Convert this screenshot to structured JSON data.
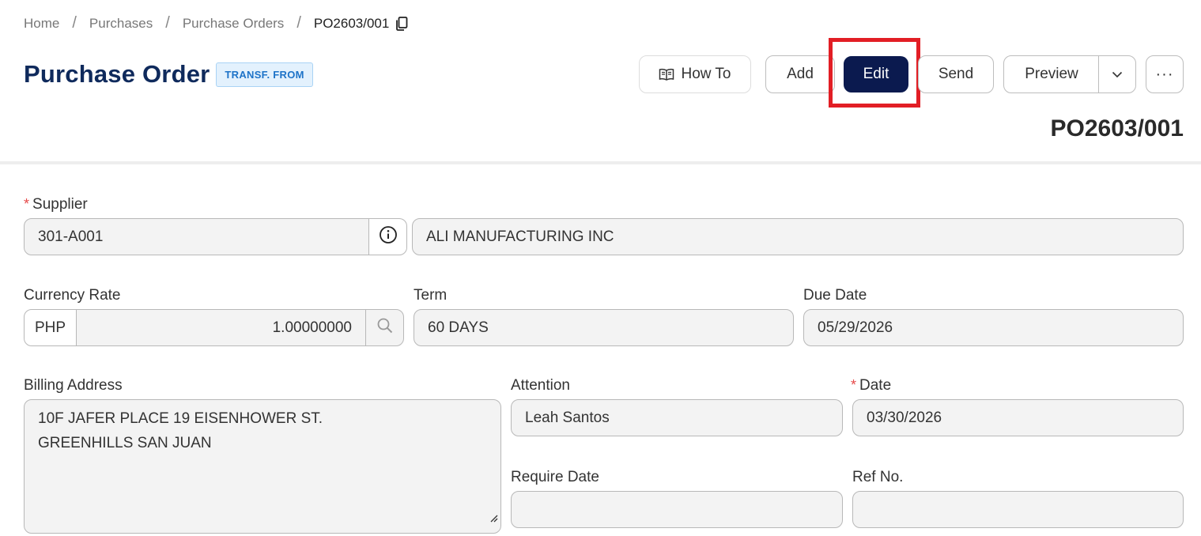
{
  "breadcrumb": {
    "home": "Home",
    "purchases": "Purchases",
    "purchase_orders": "Purchase Orders",
    "current": "PO2603/001",
    "separator": "/"
  },
  "header": {
    "title": "Purchase Order",
    "badge": "TRANSF. FROM",
    "doc_number": "PO2603/001"
  },
  "toolbar": {
    "how_to": "How To",
    "add": "Add",
    "edit": "Edit",
    "send": "Send",
    "preview": "Preview",
    "more": "···"
  },
  "form": {
    "supplier": {
      "label": "Supplier",
      "required_mark": "*",
      "code": "301-A001",
      "name": "ALI MANUFACTURING INC"
    },
    "currency_rate": {
      "label": "Currency Rate",
      "currency": "PHP",
      "rate": "1.00000000"
    },
    "term": {
      "label": "Term",
      "value": "60 DAYS"
    },
    "due_date": {
      "label": "Due Date",
      "value": "05/29/2026"
    },
    "billing_address": {
      "label": "Billing Address",
      "line1": "10F JAFER PLACE 19 EISENHOWER ST.",
      "line2": "GREENHILLS SAN JUAN"
    },
    "attention": {
      "label": "Attention",
      "value": "Leah Santos"
    },
    "date": {
      "label": "Date",
      "required_mark": "*",
      "value": "03/30/2026"
    },
    "require_date": {
      "label": "Require Date",
      "value": ""
    },
    "ref_no": {
      "label": "Ref No.",
      "value": ""
    }
  },
  "colors": {
    "title": "#0f2a5c",
    "edit_button": "#0b1a4f",
    "highlight": "#e21e25",
    "badge_bg": "#e3f1fd",
    "badge_text": "#1e73c8",
    "required": "#e64a4a"
  }
}
